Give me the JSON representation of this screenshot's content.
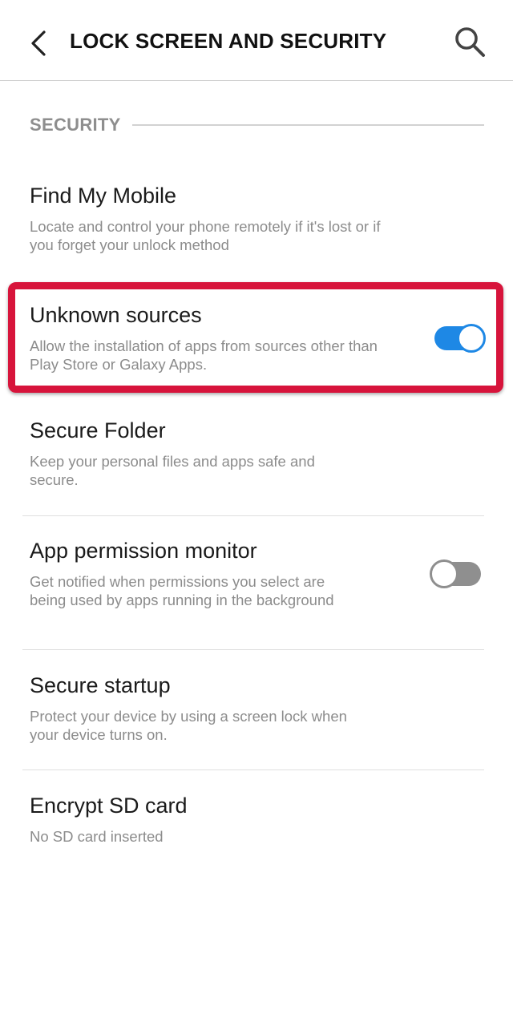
{
  "header": {
    "title": "LOCK SCREEN AND SECURITY",
    "back_icon": "chevron-left-icon",
    "search_icon": "search-icon"
  },
  "section": {
    "title": "SECURITY"
  },
  "items": [
    {
      "title": "Find My Mobile",
      "description": "Locate and control your phone remotely if it's lost or if you forget your unlock method"
    },
    {
      "title": "Unknown sources",
      "description": "Allow the installation of apps from sources other than Play Store or Galaxy Apps.",
      "toggle": "on",
      "highlighted": true
    },
    {
      "title": "Secure Folder",
      "description": "Keep your personal files and apps safe and secure."
    },
    {
      "title": "App permission monitor",
      "description": "Get notified when permissions you select are being used by apps running in the background",
      "toggle": "off"
    },
    {
      "title": "Secure startup",
      "description": "Protect your device by using a screen lock when your device turns on."
    },
    {
      "title": "Encrypt SD card",
      "description": "No SD card inserted"
    }
  ],
  "colors": {
    "toggle_on": "#1e88e5",
    "toggle_off": "#8f8f8f",
    "highlight": "#d7143b",
    "section_text": "#8e8e8e"
  }
}
